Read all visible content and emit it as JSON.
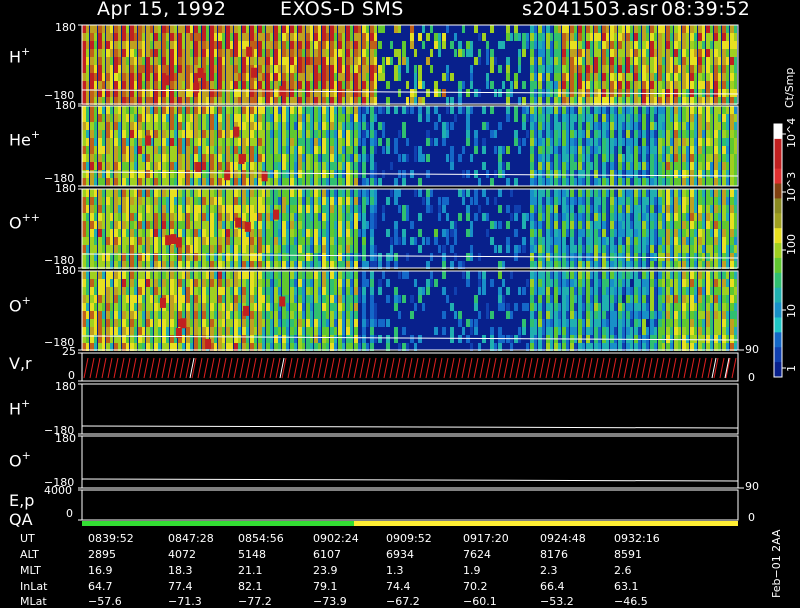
{
  "header": {
    "date": "Apr 15, 1992",
    "instrument": "EXOS-D SMS",
    "file": "s2041503.asr",
    "time": "08:39:52"
  },
  "colors": {
    "background": "#000000",
    "spectrogram_background": "#08208c",
    "green_bar": "#33dd33",
    "yellow_bar": "#ffee33"
  },
  "colorbar": {
    "unit": "Ct/Smp",
    "labels": [
      "1",
      "10",
      "100",
      "10^3",
      "10^4"
    ]
  },
  "chart_data": [
    {
      "type": "heatmap",
      "panel": "H+",
      "ylabel_ion": "H",
      "ylabel_charge": "+",
      "y_ticks": [
        "180",
        "−180"
      ],
      "ylim": [
        -180,
        180
      ],
      "colorscale": "log counts per sample (Ct/Smp), 1–10^4",
      "dominant_levels": [
        "high (yellow/green) throughout",
        "peak ~10^3 near 0845 and 0932"
      ]
    },
    {
      "type": "heatmap",
      "panel": "He+",
      "ylabel_ion": "He",
      "ylabel_charge": "+",
      "y_ticks": [
        "180",
        "−180"
      ],
      "ylim": [
        -180,
        180
      ]
    },
    {
      "type": "heatmap",
      "panel": "O++",
      "ylabel_ion": "O",
      "ylabel_charge": "++",
      "y_ticks": [
        "180",
        "−180"
      ],
      "ylim": [
        -180,
        180
      ]
    },
    {
      "type": "heatmap",
      "panel": "O+",
      "ylabel_ion": "O",
      "ylabel_charge": "+",
      "y_ticks": [
        "180",
        "−180"
      ],
      "ylim": [
        -180,
        180
      ]
    },
    {
      "type": "line",
      "panel": "V,r",
      "ylabel": "V,r",
      "y_ticks": [
        "25",
        "0"
      ],
      "right_ticks": [
        "90",
        "0"
      ]
    },
    {
      "type": "line",
      "panel": "H+ (moment)",
      "ylabel_ion": "H",
      "ylabel_charge": "+",
      "y_ticks": [
        "180",
        "−180"
      ]
    },
    {
      "type": "line",
      "panel": "O+ (moment)",
      "ylabel_ion": "O",
      "ylabel_charge": "+",
      "y_ticks": [
        "180",
        "−180"
      ]
    },
    {
      "type": "line",
      "panel": "E,p",
      "ylabel": "E,p",
      "y_ticks": [
        "4000",
        "0"
      ],
      "right_ticks": [
        "90",
        "0"
      ]
    },
    {
      "type": "bar",
      "panel": "QA",
      "ylabel": "QA",
      "segments": [
        {
          "from": "0839:52",
          "to": "0902:24",
          "color": "green"
        },
        {
          "from": "0902:24",
          "to": "0938:00",
          "color": "yellow"
        }
      ]
    }
  ],
  "ephemeris": {
    "row_labels": [
      "UT",
      "ALT",
      "MLT",
      "InLat",
      "MLat"
    ],
    "columns": [
      [
        "0839:52",
        "2895",
        "16.9",
        "64.7",
        "−57.6"
      ],
      [
        "0847:28",
        "4072",
        "18.3",
        "77.4",
        "−71.3"
      ],
      [
        "0854:56",
        "5148",
        "21.1",
        "82.1",
        "−77.2"
      ],
      [
        "0902:24",
        "6107",
        "23.9",
        "79.1",
        "−73.9"
      ],
      [
        "0909:52",
        "6934",
        "1.3",
        "74.4",
        "−67.2"
      ],
      [
        "0917:20",
        "7624",
        "1.9",
        "70.2",
        "−60.1"
      ],
      [
        "0924:48",
        "8176",
        "2.3",
        "66.4",
        "−53.2"
      ],
      [
        "0932:16",
        "8591",
        "2.6",
        "63.1",
        "−46.5"
      ]
    ]
  },
  "footer_stamp": "Feb−01 2AA"
}
